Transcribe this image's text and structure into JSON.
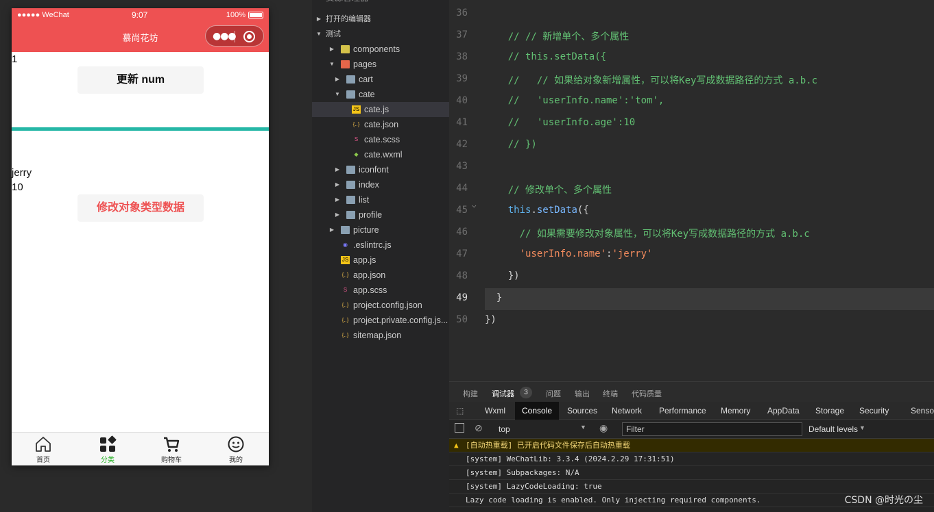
{
  "phone": {
    "status": {
      "signal": "●●●●● WeChat",
      "time": "9:07",
      "battery": "100%"
    },
    "nav_title": "慕尚花坊",
    "num_value": "1",
    "update_button": "更新 num",
    "user_name": "jerry",
    "user_age": "10",
    "modify_button": "修改对象类型数据",
    "tabs": [
      {
        "label": "首页",
        "icon": "home-icon"
      },
      {
        "label": "分类",
        "icon": "category-icon"
      },
      {
        "label": "购物车",
        "icon": "cart-icon"
      },
      {
        "label": "我的",
        "icon": "profile-icon"
      }
    ],
    "colors": {
      "nav": "#ee5152",
      "divider": "#25b7a6",
      "modify_text": "#ee5152",
      "active_tab": "#1aad19"
    }
  },
  "explorer": {
    "top_partial": "资源管理器",
    "sections": {
      "open_editors": "打开的编辑器",
      "project": "测试"
    },
    "tree": [
      {
        "label": "components",
        "depth": 1,
        "type": "folder",
        "state": "collapsed"
      },
      {
        "label": "pages",
        "depth": 1,
        "type": "folder",
        "state": "expanded"
      },
      {
        "label": "cart",
        "depth": 2,
        "type": "folder",
        "state": "collapsed"
      },
      {
        "label": "cate",
        "depth": 2,
        "type": "folder",
        "state": "expanded"
      },
      {
        "label": "cate.js",
        "depth": 3,
        "type": "js",
        "selected": true
      },
      {
        "label": "cate.json",
        "depth": 3,
        "type": "json"
      },
      {
        "label": "cate.scss",
        "depth": 3,
        "type": "scss"
      },
      {
        "label": "cate.wxml",
        "depth": 3,
        "type": "wxml"
      },
      {
        "label": "iconfont",
        "depth": 2,
        "type": "folder",
        "state": "collapsed"
      },
      {
        "label": "index",
        "depth": 2,
        "type": "folder",
        "state": "collapsed"
      },
      {
        "label": "list",
        "depth": 2,
        "type": "folder",
        "state": "collapsed"
      },
      {
        "label": "profile",
        "depth": 2,
        "type": "folder",
        "state": "collapsed"
      },
      {
        "label": "picture",
        "depth": 1,
        "type": "folder",
        "state": "collapsed"
      },
      {
        "label": ".eslintrc.js",
        "depth": 1,
        "type": "eslint"
      },
      {
        "label": "app.js",
        "depth": 1,
        "type": "js"
      },
      {
        "label": "app.json",
        "depth": 1,
        "type": "json"
      },
      {
        "label": "app.scss",
        "depth": 1,
        "type": "scss"
      },
      {
        "label": "project.config.json",
        "depth": 1,
        "type": "json"
      },
      {
        "label": "project.private.config.js...",
        "depth": 1,
        "type": "json"
      },
      {
        "label": "sitemap.json",
        "depth": 1,
        "type": "json"
      }
    ]
  },
  "editor": {
    "current_line": "49",
    "lines": [
      {
        "n": "36",
        "parts": []
      },
      {
        "n": "37",
        "parts": [
          [
            "cmt",
            "    // // 新增单个、多个属性"
          ]
        ]
      },
      {
        "n": "38",
        "parts": [
          [
            "cmt",
            "    // this.setData({"
          ]
        ]
      },
      {
        "n": "39",
        "parts": [
          [
            "cmt",
            "    //   // 如果给对象新增属性，可以将Key写成数据路径的方式 a.b.c"
          ]
        ]
      },
      {
        "n": "40",
        "parts": [
          [
            "cmt",
            "    //   'userInfo.name':'tom',"
          ]
        ]
      },
      {
        "n": "41",
        "parts": [
          [
            "cmt",
            "    //   'userInfo.age':10"
          ]
        ]
      },
      {
        "n": "42",
        "parts": [
          [
            "cmt",
            "    // })"
          ]
        ]
      },
      {
        "n": "43",
        "parts": []
      },
      {
        "n": "44",
        "parts": [
          [
            "cmt",
            "    // 修改单个、多个属性"
          ]
        ]
      },
      {
        "n": "45",
        "parts": [
          [
            "kw",
            "    this"
          ],
          [
            "pun",
            "."
          ],
          [
            "fn",
            "setData"
          ],
          [
            "pun",
            "({"
          ]
        ]
      },
      {
        "n": "46",
        "parts": [
          [
            "cmt",
            "      // 如果需要修改对象属性，可以将Key写成数据路径的方式 a.b.c"
          ]
        ]
      },
      {
        "n": "47",
        "parts": [
          [
            "str",
            "      'userInfo.name'"
          ],
          [
            "pun",
            ":"
          ],
          [
            "str",
            "'jerry'"
          ]
        ]
      },
      {
        "n": "48",
        "parts": [
          [
            "pun",
            "    })"
          ]
        ]
      },
      {
        "n": "49",
        "parts": [
          [
            "pun",
            "  }"
          ]
        ]
      },
      {
        "n": "50",
        "parts": [
          [
            "pun",
            "})"
          ]
        ]
      }
    ]
  },
  "devtools": {
    "top_tabs": [
      "构建",
      "调试器",
      "问题",
      "输出",
      "终端",
      "代码质量"
    ],
    "active_top_tab": "调试器",
    "debugger_badge": "3",
    "panel_tabs": [
      "Wxml",
      "Console",
      "Sources",
      "Network",
      "Performance",
      "Memory",
      "AppData",
      "Storage",
      "Security",
      "Sensor"
    ],
    "active_panel_tab": "Console",
    "context": "top",
    "filter_placeholder": "Filter",
    "levels": "Default levels",
    "logs": [
      {
        "type": "warn",
        "text": "[自动热重载] 已开启代码文件保存后自动热重载"
      },
      {
        "type": "info",
        "text": "[system] WeChatLib: 3.3.4 (2024.2.29 17:31:51)"
      },
      {
        "type": "info",
        "text": "[system] Subpackages: N/A"
      },
      {
        "type": "info",
        "text": "[system] LazyCodeLoading: true"
      },
      {
        "type": "info",
        "text": "Lazy code loading is enabled. Only injecting required components."
      }
    ]
  },
  "watermark": "CSDN @时光の尘"
}
